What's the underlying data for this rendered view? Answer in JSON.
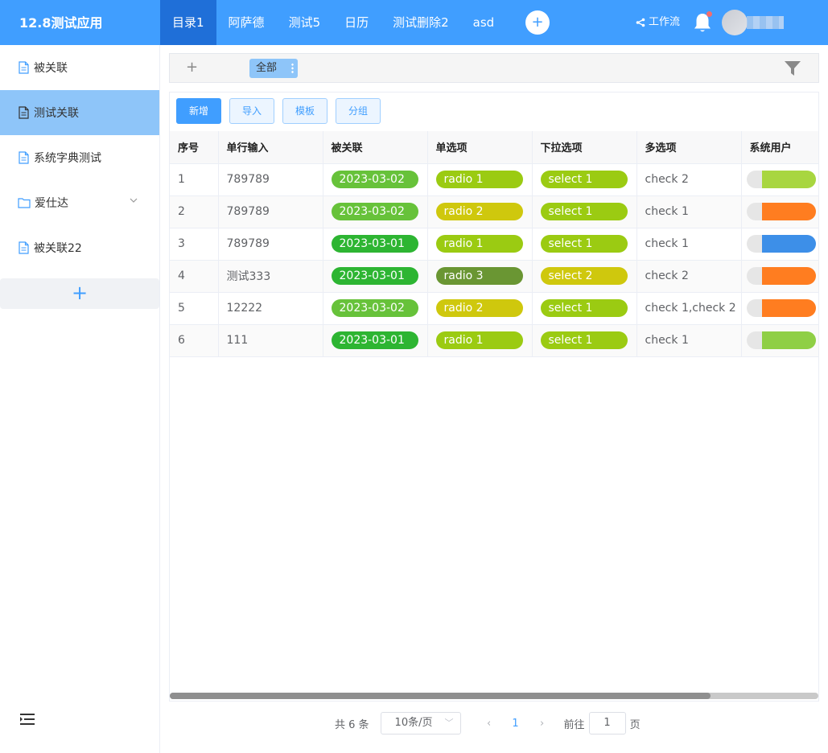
{
  "app": {
    "title": "12.8测试应用"
  },
  "nav": {
    "tabs": [
      {
        "label": "目录1",
        "active": true
      },
      {
        "label": "阿萨德"
      },
      {
        "label": "测试5"
      },
      {
        "label": "日历"
      },
      {
        "label": "测试删除2"
      },
      {
        "label": "asd"
      }
    ],
    "add_icon": "+",
    "workflow_label": "工作流",
    "has_notification": true
  },
  "sidebar": {
    "items": [
      {
        "label": "被关联",
        "icon": "document-icon"
      },
      {
        "label": "测试关联",
        "icon": "document-icon",
        "active": true
      },
      {
        "label": "系统字典测试",
        "icon": "document-icon"
      },
      {
        "label": "爱仕达",
        "icon": "folder-icon",
        "expandable": true
      },
      {
        "label": "被关联22",
        "icon": "document-icon"
      }
    ],
    "add_label": "+"
  },
  "filter": {
    "add_label": "+",
    "view_label": "全部"
  },
  "toolbar": {
    "add": "新增",
    "import": "导入",
    "template": "模板",
    "group": "分组"
  },
  "table": {
    "columns": [
      "序号",
      "单行输入",
      "被关联",
      "单选项",
      "下拉选项",
      "多选项",
      "系统用户"
    ],
    "rows": [
      {
        "index": "1",
        "text": "789789",
        "date": "2023-03-02",
        "date_color": "#67c23a",
        "radio": "radio 1",
        "radio_color": "#9bcb12",
        "select": "select 1",
        "select_color": "#9bcb12",
        "check": "check 2",
        "user_color": "#a8d640"
      },
      {
        "index": "2",
        "text": "789789",
        "date": "2023-03-02",
        "date_color": "#67c23a",
        "radio": "radio 2",
        "radio_color": "#cfc80d",
        "select": "select 1",
        "select_color": "#9bcb12",
        "check": "check 1",
        "user_color": "#ff7d20"
      },
      {
        "index": "3",
        "text": "789789",
        "date": "2023-03-01",
        "date_color": "#2db532",
        "radio": "radio 1",
        "radio_color": "#9bcb12",
        "select": "select 1",
        "select_color": "#9bcb12",
        "check": "check 1",
        "user_color": "#3d8fe8"
      },
      {
        "index": "4",
        "text": "测试333",
        "date": "2023-03-01",
        "date_color": "#2db532",
        "radio": "radio 3",
        "radio_color": "#6a9633",
        "select": "select 2",
        "select_color": "#cfc80d",
        "check": "check 2",
        "user_color": "#ff7d20"
      },
      {
        "index": "5",
        "text": "12222",
        "date": "2023-03-02",
        "date_color": "#67c23a",
        "radio": "radio 2",
        "radio_color": "#cfc80d",
        "select": "select 1",
        "select_color": "#9bcb12",
        "check": "check 1,check 2",
        "user_color": "#ff7d20"
      },
      {
        "index": "6",
        "text": "111",
        "date": "2023-03-01",
        "date_color": "#2db532",
        "radio": "radio 1",
        "radio_color": "#9bcb12",
        "select": "select 1",
        "select_color": "#9bcb12",
        "check": "check 1",
        "user_color": "#8fcf45"
      }
    ]
  },
  "pagination": {
    "total": "共 6 条",
    "page_size": "10条/页",
    "current_page": "1",
    "goto_prefix": "前往",
    "goto_value": "1",
    "goto_suffix": "页"
  },
  "colors": {
    "primary": "#409eff",
    "nav_active": "#1f6fd8",
    "sidebar_active": "#8ec5f9"
  }
}
